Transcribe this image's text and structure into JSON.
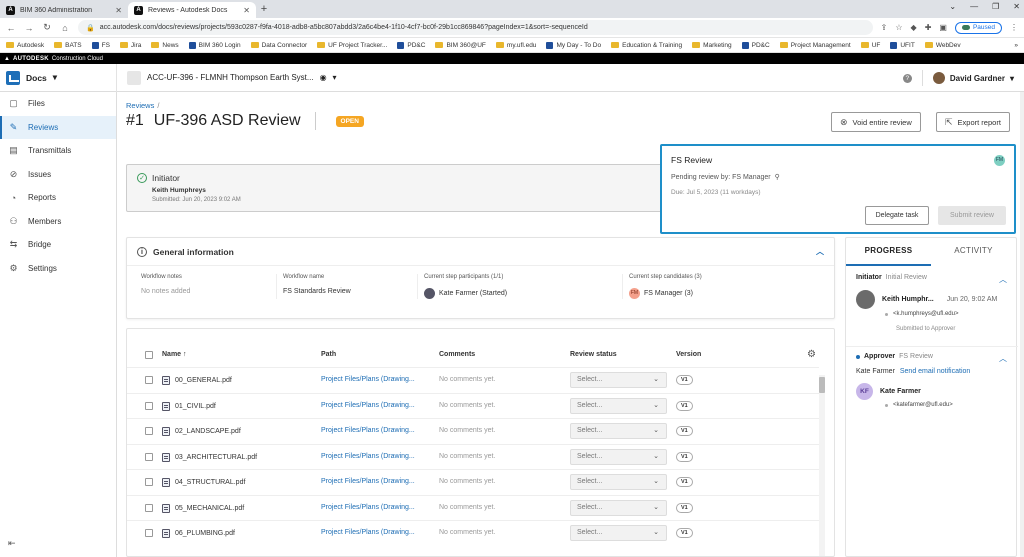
{
  "browser": {
    "tabs": [
      {
        "title": "BIM 360 Administration",
        "active": false
      },
      {
        "title": "Reviews - Autodesk Docs",
        "active": true
      }
    ],
    "url": "acc.autodesk.com/docs/reviews/projects/593c0287-f9fa-4018-adb8-a5bc807abdd3/2a6c4be4-1f10-4cf7-bc0f-29b1cc869846?pageIndex=1&sort=-sequenceId",
    "profile_status": "Paused",
    "bookmarks": [
      "Autodesk",
      "BATS",
      "FS",
      "Jira",
      "News",
      "BIM 360 Login",
      "Data Connector",
      "UF Project Tracker...",
      "PD&C",
      "BIM 360@UF",
      "my.ufl.edu",
      "My Day - To Do",
      "Education & Training",
      "Marketing",
      "PD&C",
      "Project Management",
      "UF",
      "UFIT",
      "WebDev"
    ],
    "bookmarks_more": "»"
  },
  "brand_strip": {
    "bold": "AUTODESK",
    "rest": "Construction Cloud"
  },
  "header": {
    "module": "Docs",
    "project": "ACC-UF-396 - FLMNH Thompson Earth Syst...",
    "user": "David Gardner"
  },
  "sidebar": {
    "items": [
      {
        "label": "Files",
        "icon": "file-icon"
      },
      {
        "label": "Reviews",
        "icon": "review-icon",
        "active": true
      },
      {
        "label": "Transmittals",
        "icon": "transmittal-icon"
      },
      {
        "label": "Issues",
        "icon": "issue-icon"
      },
      {
        "label": "Reports",
        "icon": "report-icon"
      },
      {
        "label": "Members",
        "icon": "members-icon"
      },
      {
        "label": "Bridge",
        "icon": "bridge-icon"
      },
      {
        "label": "Settings",
        "icon": "gear-icon"
      }
    ]
  },
  "page": {
    "breadcrumb": "Reviews",
    "breadcrumb_sep": "/",
    "number": "#1",
    "title": "UF-396 ASD Review",
    "status": "OPEN",
    "void_button": "Void entire review",
    "export_button": "Export report"
  },
  "initiator": {
    "title": "Initiator",
    "name": "Keith Humphreys",
    "submitted": "Submitted: Jun 20, 2023 9:02 AM"
  },
  "review_step": {
    "title": "FS Review",
    "badge": "FM",
    "pending": "Pending review by: FS Manager",
    "due": "Due: Jul 5, 2023 (11 workdays)",
    "delegate_button": "Delegate task",
    "submit_button": "Submit review"
  },
  "general_info": {
    "title": "General information",
    "columns": [
      {
        "label": "Workflow notes",
        "value": "No notes added"
      },
      {
        "label": "Workflow name",
        "value": "FS Standards Review"
      },
      {
        "label": "Current step participants (1/1)",
        "value": "Kate Farmer (Started)"
      },
      {
        "label": "Current step candidates (3)",
        "value": "FS Manager (3)",
        "badge": "FM"
      }
    ]
  },
  "files_table": {
    "headers": {
      "name": "Name",
      "path": "Path",
      "comments": "Comments",
      "status": "Review status",
      "version": "Version"
    },
    "rows": [
      {
        "name": "00_GENERAL.pdf",
        "path": "Project Files/Plans (Drawing...",
        "comments": "No comments yet.",
        "status": "Select...",
        "version": "V1"
      },
      {
        "name": "01_CIVIL.pdf",
        "path": "Project Files/Plans (Drawing...",
        "comments": "No comments yet.",
        "status": "Select...",
        "version": "V1"
      },
      {
        "name": "02_LANDSCAPE.pdf",
        "path": "Project Files/Plans (Drawing...",
        "comments": "No comments yet.",
        "status": "Select...",
        "version": "V1"
      },
      {
        "name": "03_ARCHITECTURAL.pdf",
        "path": "Project Files/Plans (Drawing...",
        "comments": "No comments yet.",
        "status": "Select...",
        "version": "V1"
      },
      {
        "name": "04_STRUCTURAL.pdf",
        "path": "Project Files/Plans (Drawing...",
        "comments": "No comments yet.",
        "status": "Select...",
        "version": "V1"
      },
      {
        "name": "05_MECHANICAL.pdf",
        "path": "Project Files/Plans (Drawing...",
        "comments": "No comments yet.",
        "status": "Select...",
        "version": "V1"
      },
      {
        "name": "06_PLUMBING.pdf",
        "path": "Project Files/Plans (Drawing...",
        "comments": "No comments yet.",
        "status": "Select...",
        "version": "V1"
      }
    ]
  },
  "progress_panel": {
    "tab_progress": "PROGRESS",
    "tab_activity": "ACTIVITY",
    "initiator": {
      "label": "Initiator",
      "sub": "Initial Review",
      "person": "Keith Humphr...",
      "time": "Jun 20, 9:02 AM",
      "email": "<k.humphreys@ufl.edu>",
      "note": "Submitted to Approver"
    },
    "approver": {
      "label": "Approver",
      "sub": "FS Review",
      "assignee": "Kate Farmer",
      "link": "Send email notification",
      "initials": "KF",
      "person": "Kate Farmer",
      "email": "<katefarmer@ufl.edu>"
    }
  },
  "colors": {
    "accent": "#1d6db4",
    "open_badge": "#f5a623",
    "active_card_border": "#1e8fc9"
  }
}
